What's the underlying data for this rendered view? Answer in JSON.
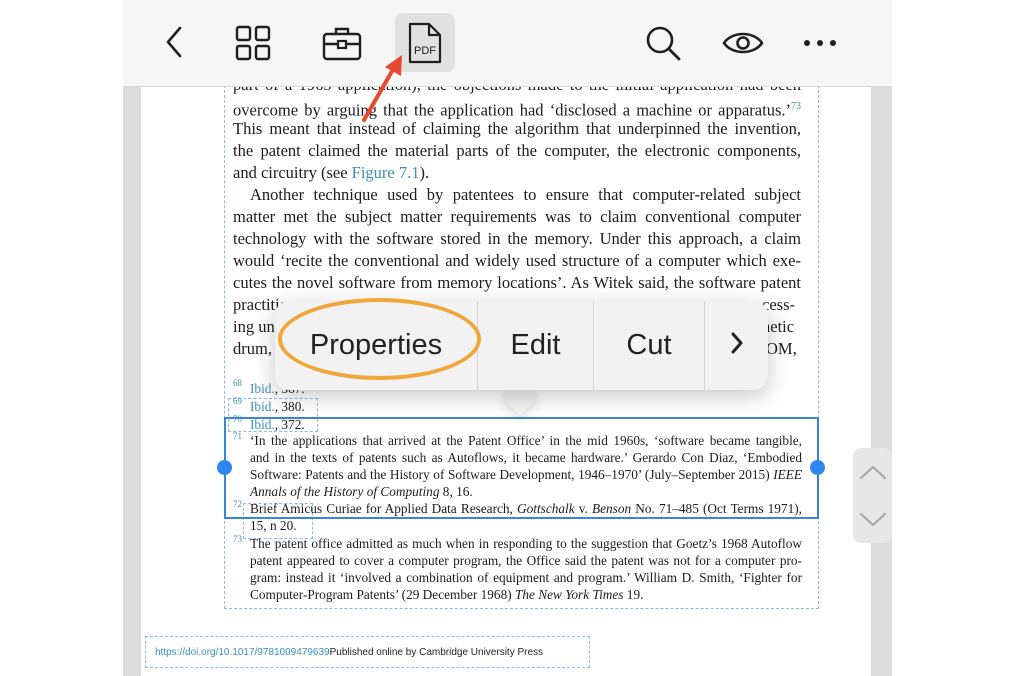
{
  "toolbar": {
    "back_icon": "chevron-left-icon",
    "grid_icon": "grid-icon",
    "toolbox_icon": "toolbox-icon",
    "pdf_icon_label": "PDF",
    "search_icon": "search-icon",
    "eye_icon": "eye-icon",
    "more_icon": "more-dots-icon"
  },
  "body_lines": [
    "part of a 1965 application), the objections made to the initial application had been",
    "overcome by arguing that the application had ‘disclosed a machine or apparatus.’",
    "This meant that instead of claiming the algorithm that underpinned the invention,",
    "the patent claimed the material parts of the computer, the electronic components,",
    "and circuitry (see",
    "Another technique used by patentees to ensure that computer-related subject",
    "matter met the subject matter requirements was to claim conventional computer",
    "technology with the software stored in the memory. Under this approach, a claim",
    "would ‘recite the conventional and widely used structure of a computer which exe-",
    "cutes the novel software from memory locations’. As Witek said, the software patent",
    "practitio",
    "ing un",
    "drum,"
  ],
  "body_right_fragments": [
    "cess-",
    "netic",
    "OM,"
  ],
  "body_links": {
    "figure_ref": "Figure 7.1",
    "figure_ref_tail": ").",
    "note_73": "73"
  },
  "footnotes": {
    "n68": {
      "num": "68",
      "ref": "Ibid.",
      "text": ", 367."
    },
    "n69": {
      "num": "69",
      "ref": "Ibid.",
      "text": ", 380."
    },
    "n70": {
      "num": "70",
      "ref": "Ibid.",
      "text": ", 372."
    },
    "n71": {
      "num": "71",
      "line1": "‘In the applications that arrived at the Patent Office’ in the mid 1960s, ‘software became tangible,",
      "line2": "and in the texts of patents such as Autoflows, it became hardware.’ Gerardo Con Diaz, ‘Embodied",
      "line3a": "Software: Patents and the History of Software Development, 1946–1970’ (July–September 2015)",
      "line3b": "IEEE",
      "line4a": "Annals of the History of Computing",
      "line4b": " 8, 16."
    },
    "n72": {
      "num": "72",
      "line1a": "Brief Amicus Curiae for Applied Data Research, ",
      "line1b": "Gottschalk",
      "line1c": " v. ",
      "line1d": "Benson",
      "line1e": " No. 71–485 (Oct Terms 1971),",
      "line2": "15, n 20."
    },
    "n73": {
      "num": "73",
      "line1": "The patent office admitted as much when in responding to the suggestion that Goetz’s 1968 Autoflow",
      "line2": "patent appeared to cover a computer program, the Office said the patent was not for a computer pro-",
      "line3": "gram: instead it ‘involved a combination of equipment and program.’ William D. Smith, ‘Fighter for",
      "line4a": "Computer-Program Patents’ (29 December 1968) ",
      "line4b": "The New York Times",
      "line4c": " 19."
    }
  },
  "context_menu": {
    "items": [
      "Properties",
      "Edit",
      "Cut"
    ],
    "more_icon": "chevron-right-icon"
  },
  "scroller": {
    "up_icon": "chevron-up-icon",
    "down_icon": "chevron-down-icon"
  },
  "footer": {
    "doi": "https://doi.org/10.1017/9781009479639",
    "published": " Published online by Cambridge University Press"
  },
  "colors": {
    "toolbar_bg": "#f6f6f6",
    "annotation_arrow": "#e8492e",
    "highlight_ring": "#f0a73a",
    "selection": "#3a86d6",
    "dashed_box": "#8cb8e6",
    "link": "#3a8fb7"
  }
}
